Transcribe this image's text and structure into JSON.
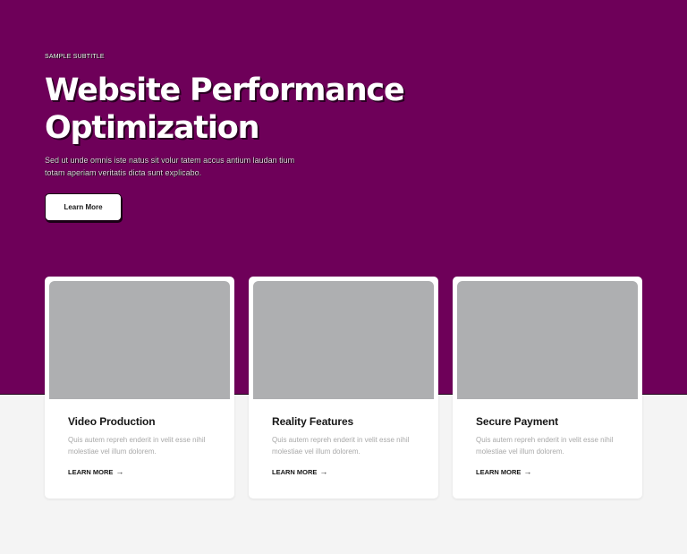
{
  "hero": {
    "subtitle": "SAMPLE SUBTITLE",
    "title": "Website Performance Optimization",
    "description": "Sed ut unde omnis iste natus sit volur tatem accus antium laudan tium totam aperiam veritatis dicta sunt explicabo.",
    "cta_label": "Learn More",
    "background_color": "#6e0059"
  },
  "cards": [
    {
      "title": "Video Production",
      "text": "Quis autem repreh enderit in velit esse nihil molestiae vel illum dolorem.",
      "link_label": "LEARN MORE",
      "link_icon": "arrow-right-icon"
    },
    {
      "title": "Reality Features",
      "text": "Quis autem repreh enderit in velit esse nihil molestiae vel illum dolorem.",
      "link_label": "LEARN MORE",
      "link_icon": "arrow-right-icon"
    },
    {
      "title": "Secure Payment",
      "text": "Quis autem repreh enderit in velit esse nihil molestiae vel illum dolorem.",
      "link_label": "LEARN MORE",
      "link_icon": "arrow-right-icon"
    }
  ]
}
